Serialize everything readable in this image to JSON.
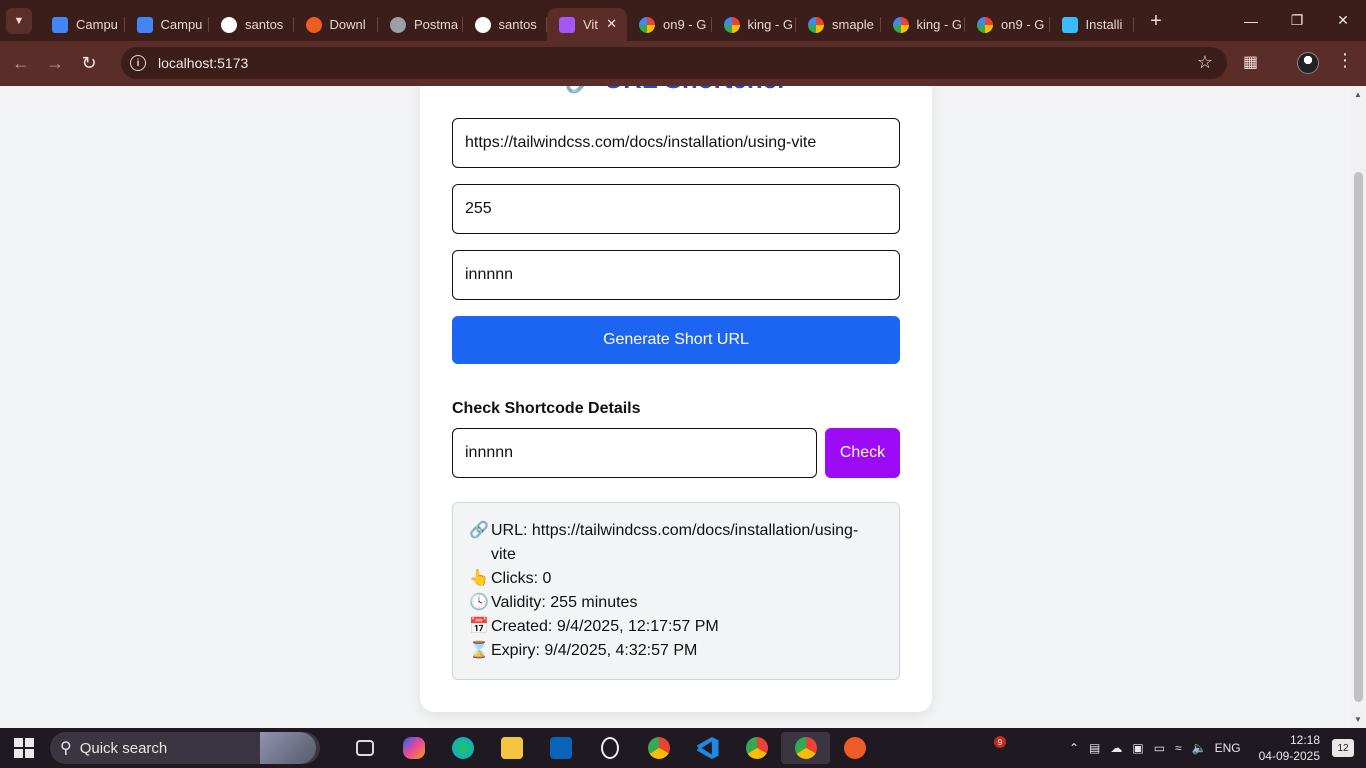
{
  "browser": {
    "tabs": [
      {
        "title": "Campu",
        "icon": "docs-icon",
        "color": "#4285f4"
      },
      {
        "title": "Campu",
        "icon": "docs-icon",
        "color": "#4285f4"
      },
      {
        "title": "santos",
        "icon": "github-icon",
        "color": "#ffffff"
      },
      {
        "title": "Downl",
        "icon": "postman-icon",
        "color": "#ef5b25"
      },
      {
        "title": "Postma",
        "icon": "globe-icon",
        "color": "#9aa0a6"
      },
      {
        "title": "santos",
        "icon": "github-icon",
        "color": "#ffffff"
      },
      {
        "title": "Vit",
        "icon": "vite-icon",
        "color": "#a855f7",
        "active": true
      },
      {
        "title": "on9 - G",
        "icon": "google-icon",
        "color": "#ffffff"
      },
      {
        "title": "king - G",
        "icon": "google-icon",
        "color": "#ffffff"
      },
      {
        "title": "smaple",
        "icon": "google-icon",
        "color": "#ffffff"
      },
      {
        "title": "king - G",
        "icon": "google-icon",
        "color": "#ffffff"
      },
      {
        "title": "on9 - G",
        "icon": "google-icon",
        "color": "#ffffff"
      },
      {
        "title": "Installi",
        "icon": "tailwind-icon",
        "color": "#38bdf8"
      }
    ],
    "address": "localhost:5173"
  },
  "app": {
    "title": "URL Shortener",
    "url_value": "https://tailwindcss.com/docs/installation/using-vite",
    "validity_value": "255",
    "shortcode_value": "innnnn",
    "generate_label": "Generate Short URL",
    "check_section_title": "Check Shortcode Details",
    "check_input_value": "innnnn",
    "check_label": "Check",
    "details": {
      "url_label": "URL: https://tailwindcss.com/docs/installation/using-vite",
      "clicks_label": "Clicks: 0",
      "validity_label": "Validity: 255 minutes",
      "created_label": "Created: 9/4/2025, 12:17:57 PM",
      "expiry_label": "Expiry: 9/4/2025, 4:32:57 PM"
    }
  },
  "taskbar": {
    "search_placeholder": "Quick search",
    "language": "ENG",
    "time": "12:18",
    "date": "04-09-2025",
    "badge_count": "9",
    "notification_count": "12"
  },
  "colors": {
    "generate_button": "#1c64f2",
    "check_button": "#9d0af5",
    "title": "#1d4ed8"
  }
}
